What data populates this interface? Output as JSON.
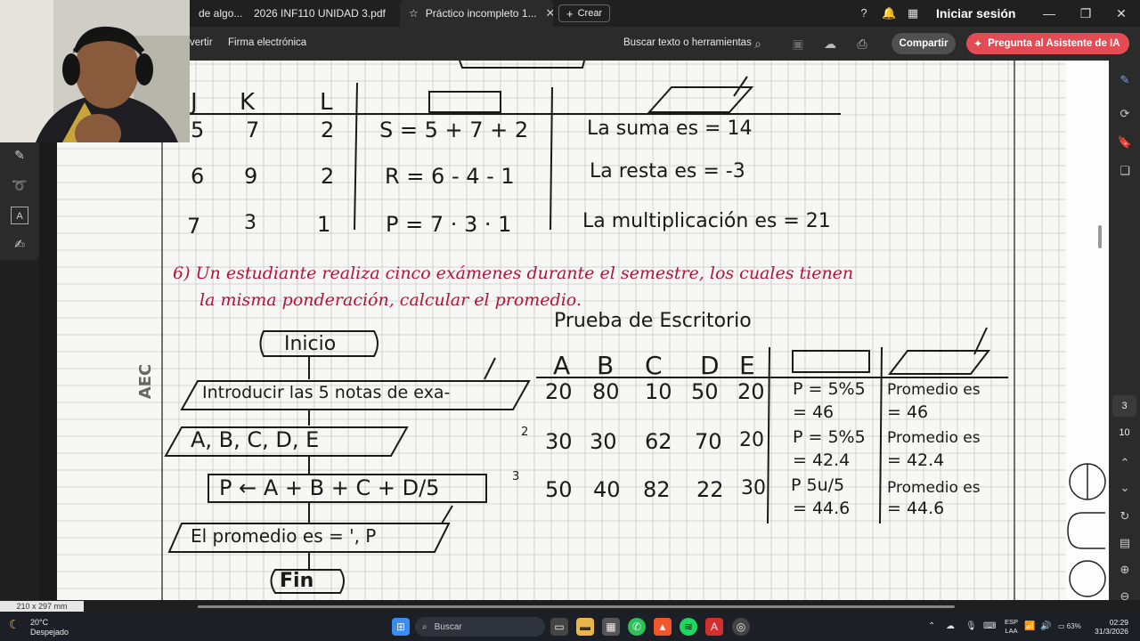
{
  "browser": {
    "tabs": [
      {
        "label": "de algo..."
      },
      {
        "label": "2026 INF110 UNIDAD 3.pdf"
      },
      {
        "label": "Práctico incompleto 1..."
      }
    ],
    "new_label": "Crear",
    "signin_label": "Iniciar sesión"
  },
  "toolbar": {
    "convert_label": "vertir",
    "esign_label": "Firma electrónica",
    "find_label": "Buscar texto o herramientas",
    "share_label": "Compartir",
    "ai_label": "Pregunta al Asistente de IA"
  },
  "document": {
    "table1": {
      "headers": [
        "J",
        "K",
        "L"
      ],
      "rows": [
        {
          "j": "5",
          "k": "7",
          "l": "2",
          "formula": "S = 5 + 7 + 2",
          "result": "La suma es = 14"
        },
        {
          "j": "6",
          "k": "9",
          "l": "2",
          "formula": "R = 6 - 4 - 1",
          "result": "La resta es = -3"
        },
        {
          "j": "7",
          "k": "3",
          "l": "1",
          "formula": "P = 7 · 3 · 1",
          "result": "La multiplicación es = 21"
        }
      ]
    },
    "problem": {
      "line1": "6) Un estudiante realiza cinco exámenes durante el semestre, los cuales tienen",
      "line2": "la misma ponderación, calcular el promedio."
    },
    "desk_test_title": "Prueba de Escritorio",
    "flowchart": {
      "start": "Inicio",
      "input_prompt": "Introducir las 5 notas de exa-",
      "input_vars": "A, B, C, D, E",
      "process": "P ← A + B + C + D/5",
      "output": "El promedio es = ', P",
      "end": "Fin"
    },
    "table2": {
      "headers": [
        "A",
        "B",
        "C",
        "D",
        "E"
      ],
      "rows": [
        {
          "marker": "",
          "a": "20",
          "b": "80",
          "c": "10",
          "d": "50",
          "e": "20",
          "calc1": "P = 5%5",
          "calc2": "= 46",
          "out1": "Promedio es",
          "out2": "= 46"
        },
        {
          "marker": "2",
          "a": "30",
          "b": "30",
          "c": "62",
          "d": "70",
          "e": "20",
          "calc1": "P = 5%5",
          "calc2": "= 42.4",
          "out1": "Promedio es",
          "out2": "= 42.4"
        },
        {
          "marker": "3",
          "a": "50",
          "b": "40",
          "c": "82",
          "d": "22",
          "e": "30",
          "calc1": "P 5u/5",
          "calc2": "= 44.6",
          "out1": "Promedio es",
          "out2": "= 44.6"
        }
      ]
    },
    "side_stamp": "AEC"
  },
  "right_panel": {
    "page_current": "3",
    "page_total": "10"
  },
  "status": {
    "page_size": "210 x 297 mm"
  },
  "taskbar": {
    "weather_temp": "20°C",
    "weather_desc": "Despejado",
    "search_label": "Buscar",
    "lang_line1": "ESP",
    "lang_line2": "LAA",
    "battery": "63%",
    "time": "02:29",
    "date": "31/3/2026"
  },
  "colors": {
    "accent_ai": "#e34b55",
    "ink_red": "#b01438"
  }
}
